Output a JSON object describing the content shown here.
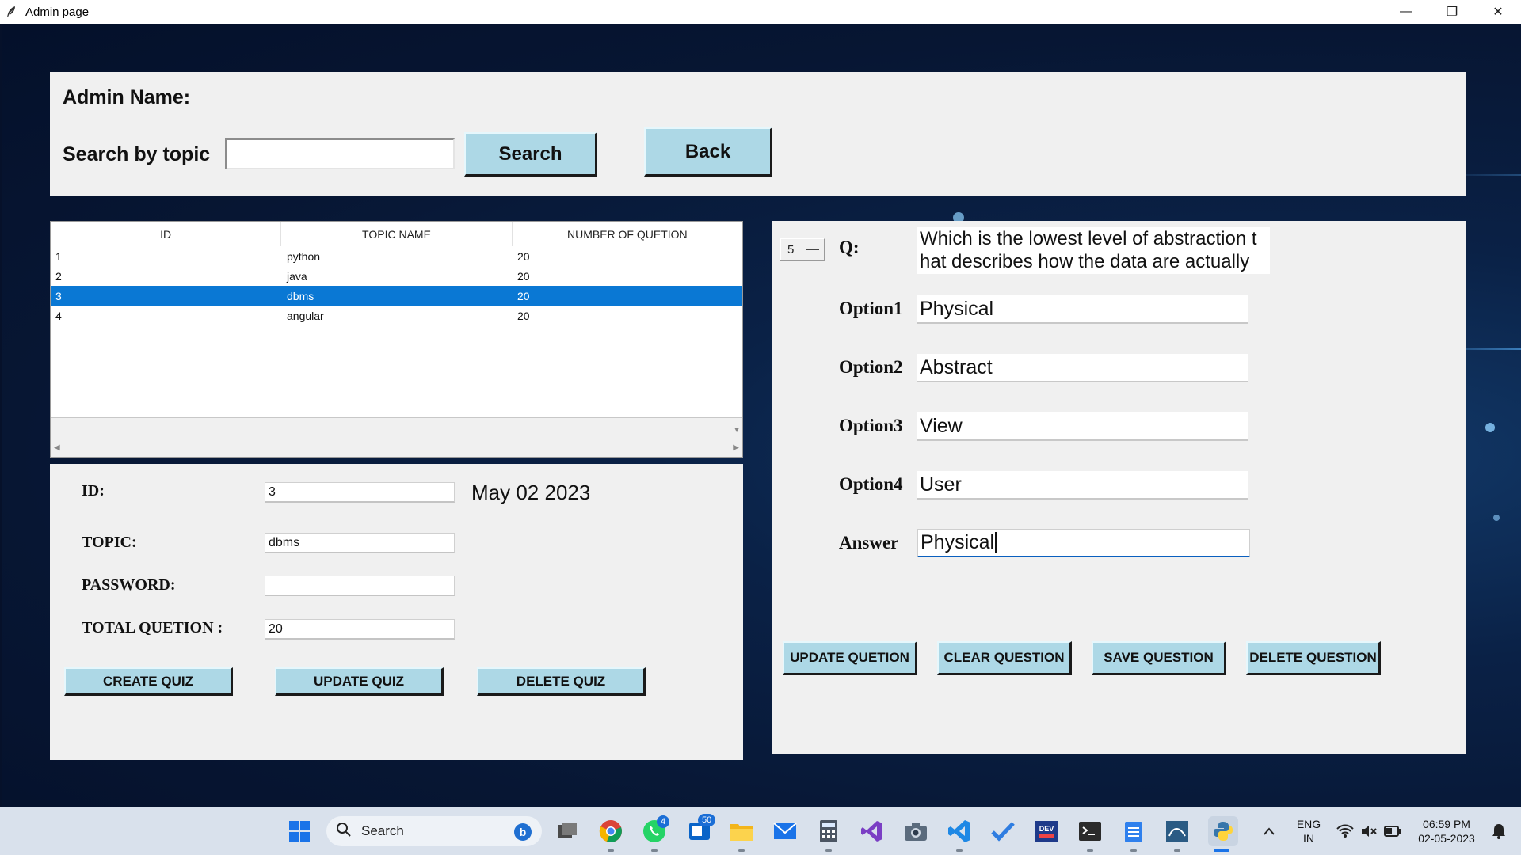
{
  "window": {
    "title": "Admin page",
    "controls": {
      "minimize": "—",
      "maximize": "❐",
      "close": "✕"
    }
  },
  "top": {
    "admin_label": "Admin Name:",
    "search_label": "Search by topic",
    "search_value": "",
    "search_button": "Search",
    "back_button": "Back"
  },
  "table": {
    "headers": [
      "ID",
      "TOPIC NAME",
      "NUMBER OF QUETION"
    ],
    "rows": [
      {
        "id": "1",
        "topic": "python",
        "count": "20"
      },
      {
        "id": "2",
        "topic": "java",
        "count": "20"
      },
      {
        "id": "3",
        "topic": "dbms",
        "count": "20"
      },
      {
        "id": "4",
        "topic": "angular",
        "count": "20"
      }
    ],
    "selected_row": 3
  },
  "quiz_form": {
    "id_label": "ID:",
    "id_value": "3",
    "date": "May 02 2023",
    "topic_label": "TOPIC:",
    "topic_value": "dbms",
    "password_label": "PASSWORD:",
    "password_value": "",
    "total_label": "TOTAL QUETION :",
    "total_value": "20",
    "create_button": "CREATE QUIZ",
    "update_button": "UPDATE QUIZ",
    "delete_button": "DELETE QUIZ"
  },
  "question": {
    "number": "5",
    "q_label": "Q:",
    "q_line1": "Which is the lowest level of abstraction t",
    "q_line2": "hat describes how the data are actually",
    "option1_label": "Option1",
    "option1_value": "Physical",
    "option2_label": "Option2",
    "option2_value": "Abstract",
    "option3_label": "Option3",
    "option3_value": "View",
    "option4_label": "Option4",
    "option4_value": "User",
    "answer_label": "Answer",
    "answer_value": "Physical",
    "update_button": "UPDATE QUETION",
    "clear_button": "CLEAR QUESTION",
    "save_button": "SAVE QUESTION",
    "delete_button": "DELETE QUESTION"
  },
  "taskbar": {
    "search_label": "Search",
    "whatsapp_badge": "4",
    "outlook_badge": "50",
    "language_line1": "ENG",
    "language_line2": "IN",
    "time": "06:59 PM",
    "date": "02-05-2023"
  },
  "colors": {
    "button_bg": "#add8e6",
    "panel_bg": "#f0f0f0",
    "selection": "#0a78d4",
    "background": "#071633"
  }
}
